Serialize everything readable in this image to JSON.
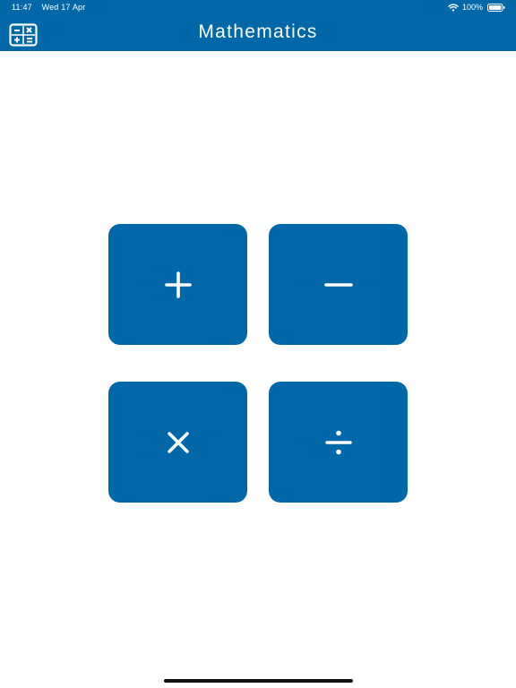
{
  "status_bar": {
    "time": "11:47",
    "date": "Wed 17 Apr",
    "battery": "100%",
    "wifi_icon": "wifi-icon",
    "battery_icon": "battery-icon"
  },
  "nav": {
    "title": "Mathematics",
    "icon": "calculator-icon"
  },
  "operations": [
    {
      "label": "addition",
      "icon": "plus-icon"
    },
    {
      "label": "subtraction",
      "icon": "minus-icon"
    },
    {
      "label": "multiplication",
      "icon": "times-icon"
    },
    {
      "label": "division",
      "icon": "divide-icon"
    }
  ],
  "colors": {
    "primary": "#0068a8",
    "background": "#ffffff",
    "foreground": "#ffffff"
  }
}
